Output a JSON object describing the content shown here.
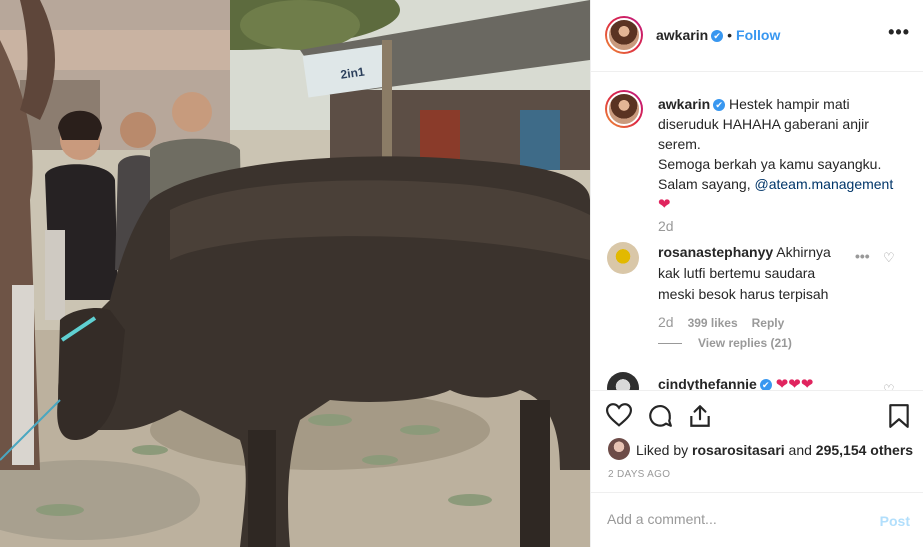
{
  "photo": {
    "alt": "",
    "banner_text": "2in1"
  },
  "post_header": {
    "username": "awkarin",
    "verified_badge": "✔",
    "separator": "•",
    "follow_label": "Follow",
    "more_label": "•••"
  },
  "caption": {
    "username": "awkarin",
    "verified_badge": "✔",
    "line1": "Hestek hampir mati diseruduk HAHAHA gaberani anjir serem.",
    "line2": "Semoga berkah ya kamu sayangku.",
    "line3_prefix": "Salam sayang, ",
    "mention": "@ateam.management",
    "emoji": "❤",
    "time": "2d"
  },
  "comments": [
    {
      "username": "rosanastephanyy",
      "text": "Akhirnya kak lutfi bertemu saudara meski besok harus terpisah",
      "time": "2d",
      "likes": "399 likes",
      "reply_label": "Reply",
      "view_replies": "View replies (21)"
    },
    {
      "username": "cindythefannie",
      "verified_badge": "✔",
      "text": "❤❤❤"
    }
  ],
  "actions": {
    "like_icon": "heart-outline-icon",
    "comment_icon": "comment-bubble-icon",
    "share_icon": "share-icon",
    "save_icon": "bookmark-icon"
  },
  "likes_summary": {
    "prefix": "Liked by ",
    "user": "rosarositasari",
    "middle": " and ",
    "count": "295,154 others"
  },
  "post_date": "2 DAYS AGO",
  "add_comment": {
    "placeholder": "Add a comment...",
    "post_label": "Post"
  },
  "colors": {
    "accent": "#3897f0",
    "text": "#262626",
    "muted": "#999999",
    "post_disabled": "#b2dffc"
  }
}
